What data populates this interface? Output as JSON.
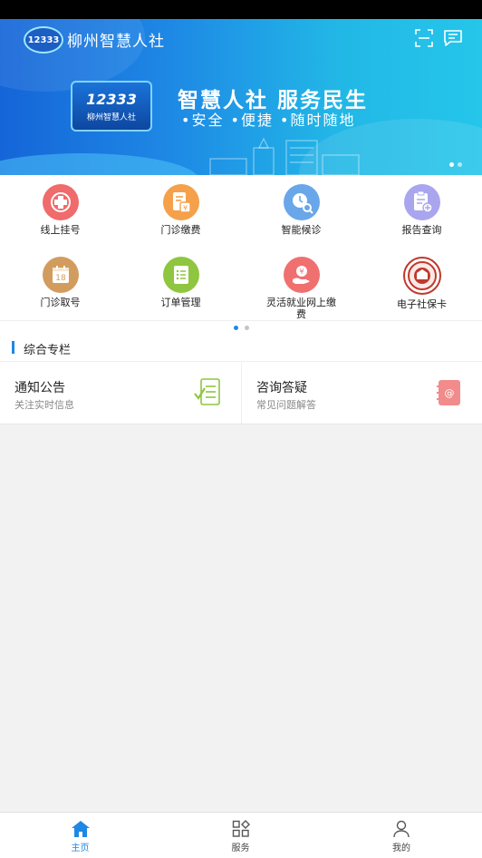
{
  "header": {
    "app_title": "柳州智慧人社",
    "logo_text": "12333",
    "icons": [
      "scan-icon",
      "message-icon"
    ]
  },
  "banner": {
    "logo_number": "12333",
    "logo_caption": "柳州智慧人社",
    "slogan": "智慧人社 服务民生",
    "subslogan": "•安全 •便捷 •随时随地"
  },
  "services": [
    {
      "label": "线上挂号",
      "icon": "registration-icon",
      "color": "#f06b6b"
    },
    {
      "label": "门诊缴费",
      "icon": "payment-bill-icon",
      "color": "#f5a04a"
    },
    {
      "label": "智能候诊",
      "icon": "waiting-clock-icon",
      "color": "#6aa6ea"
    },
    {
      "label": "报告查询",
      "icon": "report-icon",
      "color": "#a9a6ef"
    },
    {
      "label": "门诊取号",
      "icon": "calendar-icon",
      "color": "#d29c5e",
      "calendar_day": "18"
    },
    {
      "label": "订单管理",
      "icon": "order-list-icon",
      "color": "#8ec63f"
    },
    {
      "label": "灵活就业网上缴费",
      "icon": "hand-coin-icon",
      "color": "#f07070"
    },
    {
      "label": "电子社保卡",
      "icon": "social-security-badge-icon",
      "color": "#c0392b"
    }
  ],
  "section": {
    "title": "综合专栏",
    "cards": [
      {
        "title": "通知公告",
        "subtitle": "关注实时信息",
        "icon": "notice-document-icon"
      },
      {
        "title": "咨询答疑",
        "subtitle": "常见问题解答",
        "icon": "contact-book-icon"
      }
    ]
  },
  "tabbar": {
    "tabs": [
      {
        "label": "主页",
        "icon": "home-icon",
        "active": true
      },
      {
        "label": "服务",
        "icon": "grid-icon",
        "active": false
      },
      {
        "label": "我的",
        "icon": "user-icon",
        "active": false
      }
    ],
    "accent": "#1e88e5"
  }
}
